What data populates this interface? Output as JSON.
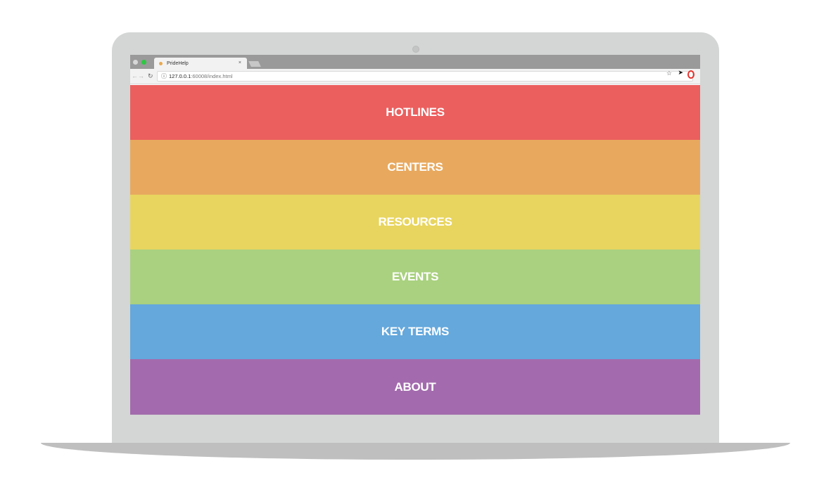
{
  "browser": {
    "tab_title": "PrideHelp",
    "tab_close": "×",
    "url_host": "127.0.0.1",
    "url_path": ":60008/index.html",
    "icons": {
      "back": "arrow-left",
      "forward": "arrow-right",
      "reload": "reload",
      "info": "info-circle",
      "star": "star",
      "extension": "cursor-extension",
      "opera": "opera-logo"
    }
  },
  "menu": {
    "items": [
      {
        "label": "HOTLINES",
        "color": "#eb5f5e"
      },
      {
        "label": "CENTERS",
        "color": "#e8a95f"
      },
      {
        "label": "RESOURCES",
        "color": "#e8d55f"
      },
      {
        "label": "EVENTS",
        "color": "#a9d17f"
      },
      {
        "label": "KEY TERMS",
        "color": "#64a8dc"
      },
      {
        "label": "ABOUT",
        "color": "#a36bad"
      }
    ]
  }
}
